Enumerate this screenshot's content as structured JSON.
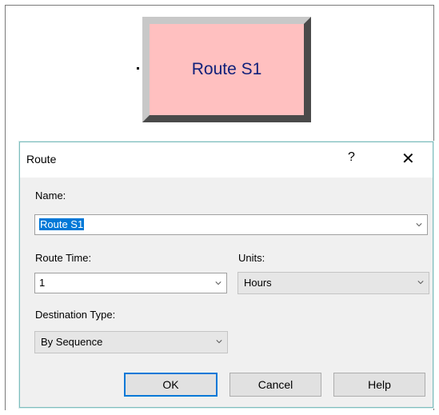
{
  "canvas": {
    "block_label": "Route S1"
  },
  "dialog": {
    "title": "Route",
    "help_glyph": "?",
    "close_glyph": "✕",
    "name_label": "Name:",
    "name_value": "Route S1",
    "route_time_label": "Route Time:",
    "route_time_value": "1",
    "units_label": "Units:",
    "units_value": "Hours",
    "destination_type_label": "Destination Type:",
    "destination_type_value": "By Sequence",
    "ok_label": "OK",
    "cancel_label": "Cancel",
    "help_label": "Help"
  },
  "icons": {
    "chevron": "chevron-down-icon",
    "close": "close-icon",
    "help": "help-icon"
  },
  "colors": {
    "block_fill": "#ffc0c0",
    "block_text": "#10207a",
    "selection": "#0078d7",
    "dialog_border": "#7fbdbd"
  }
}
